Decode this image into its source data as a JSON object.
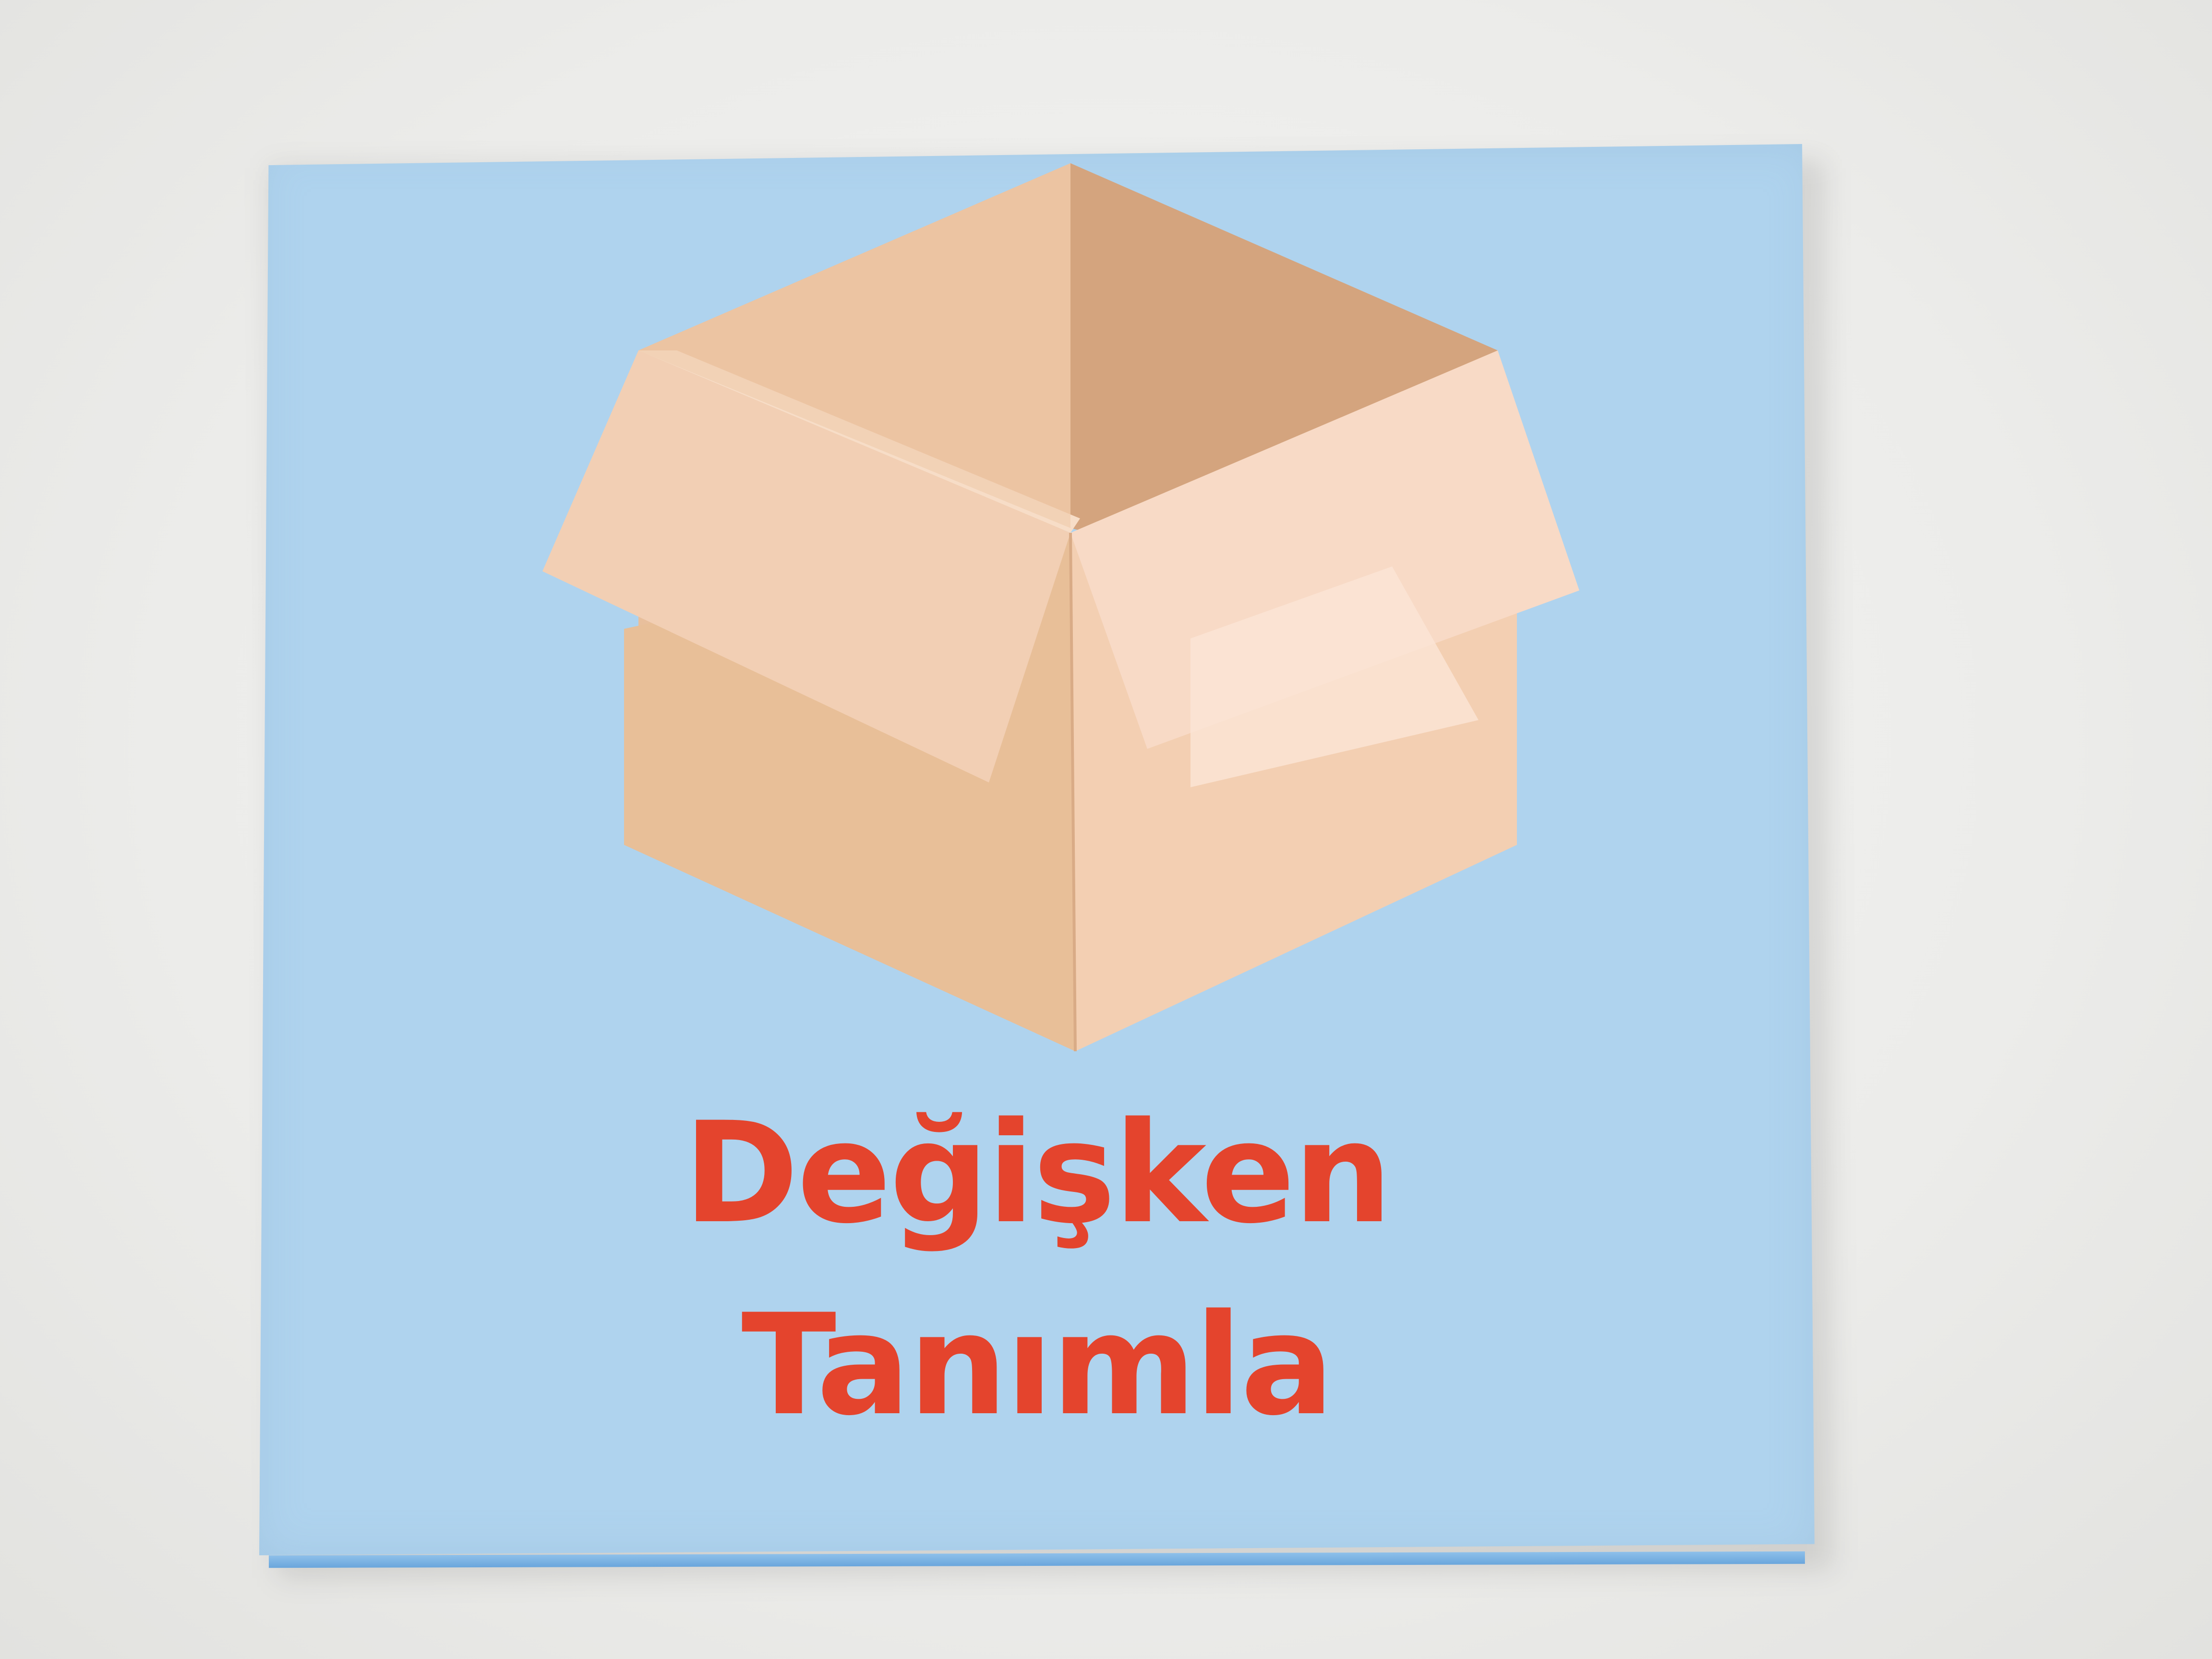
{
  "card": {
    "background_color": "#afd3ee",
    "illustration": "open-cardboard-box-icon",
    "title_lines": [
      "Değişken",
      "Tanımla"
    ],
    "title_color": "#e4442d"
  }
}
